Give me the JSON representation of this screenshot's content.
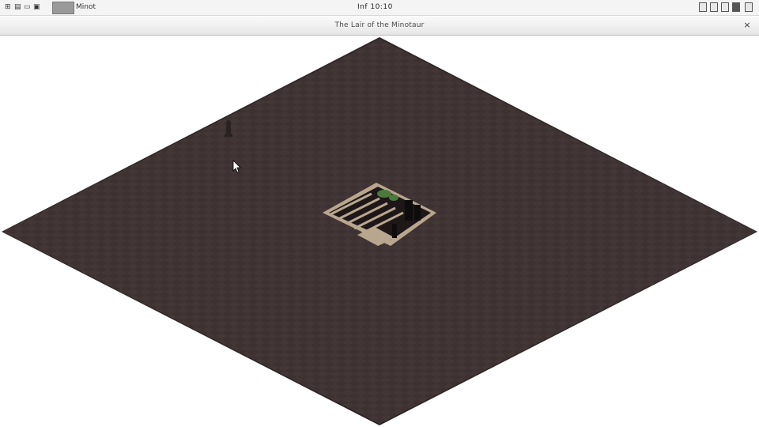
{
  "window": {
    "title": "The Lair of the Minotaur",
    "close_symbol": "×"
  },
  "system_bar": {
    "task_label": "Minot",
    "clock": "Inf 10:10"
  },
  "game": {
    "floor_color": "#3d3132",
    "floor_tile_color": "#463a3b",
    "floor_edge_color": "#2e2425",
    "wall_frame_color": "#b8a78e",
    "pit_color": "#1e1718",
    "foliage_color": "#4c7a3e",
    "player_color": "#2a2222",
    "cursor_color": "#ffffff"
  }
}
